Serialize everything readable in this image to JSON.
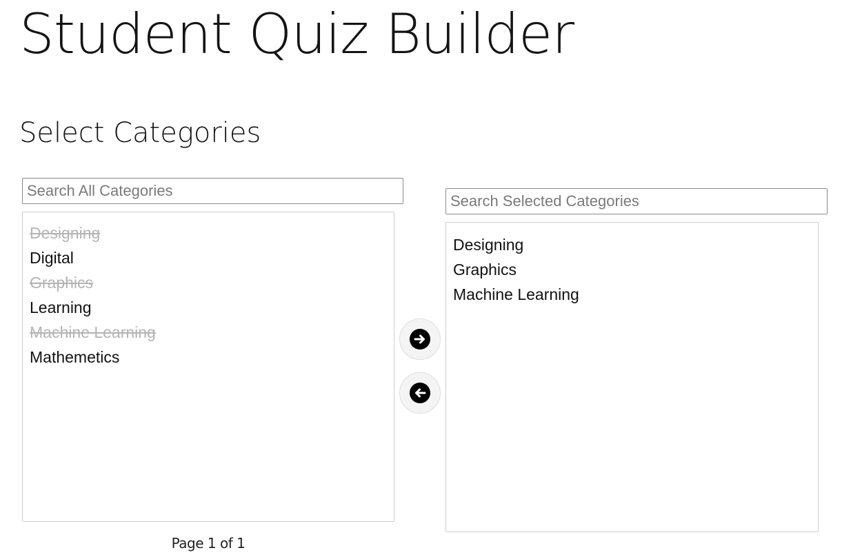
{
  "header": {
    "title": "Student Quiz Builder"
  },
  "section": {
    "title": "Select Categories"
  },
  "available": {
    "search_placeholder": "Search All Categories",
    "search_value": "",
    "items": [
      {
        "label": "Designing",
        "selected": true
      },
      {
        "label": "Digital",
        "selected": false
      },
      {
        "label": "Graphics",
        "selected": true
      },
      {
        "label": "Learning",
        "selected": false
      },
      {
        "label": "Machine Learning",
        "selected": true
      },
      {
        "label": "Mathemetics",
        "selected": false
      }
    ],
    "pagination": "Page 1 of 1"
  },
  "selected": {
    "search_placeholder": "Search Selected Categories",
    "search_value": "",
    "items": [
      {
        "label": "Designing"
      },
      {
        "label": "Graphics"
      },
      {
        "label": "Machine Learning"
      }
    ]
  },
  "controls": {
    "move_right_icon": "arrow-right-circle-icon",
    "move_left_icon": "arrow-left-circle-icon"
  }
}
